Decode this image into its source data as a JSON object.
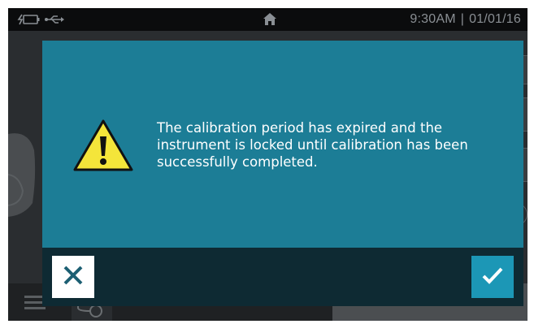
{
  "statusbar": {
    "time": "9:30AM",
    "separator": "|",
    "date": "01/01/16",
    "icons": [
      "battery-charging-icon",
      "usb-icon",
      "home-icon"
    ]
  },
  "dialog": {
    "icon": "warning-icon",
    "message": "The calibration period has expired and the instrument is locked until calibration has been successfully completed.",
    "cancel_icon": "close-icon",
    "confirm_icon": "checkmark-icon"
  },
  "colors": {
    "dialog_background": "#1c7d96",
    "footer_background": "#0e2a33",
    "confirm_button": "#1c97b6",
    "warning_yellow": "#f4e53a"
  },
  "background": {
    "help_label": "?"
  }
}
